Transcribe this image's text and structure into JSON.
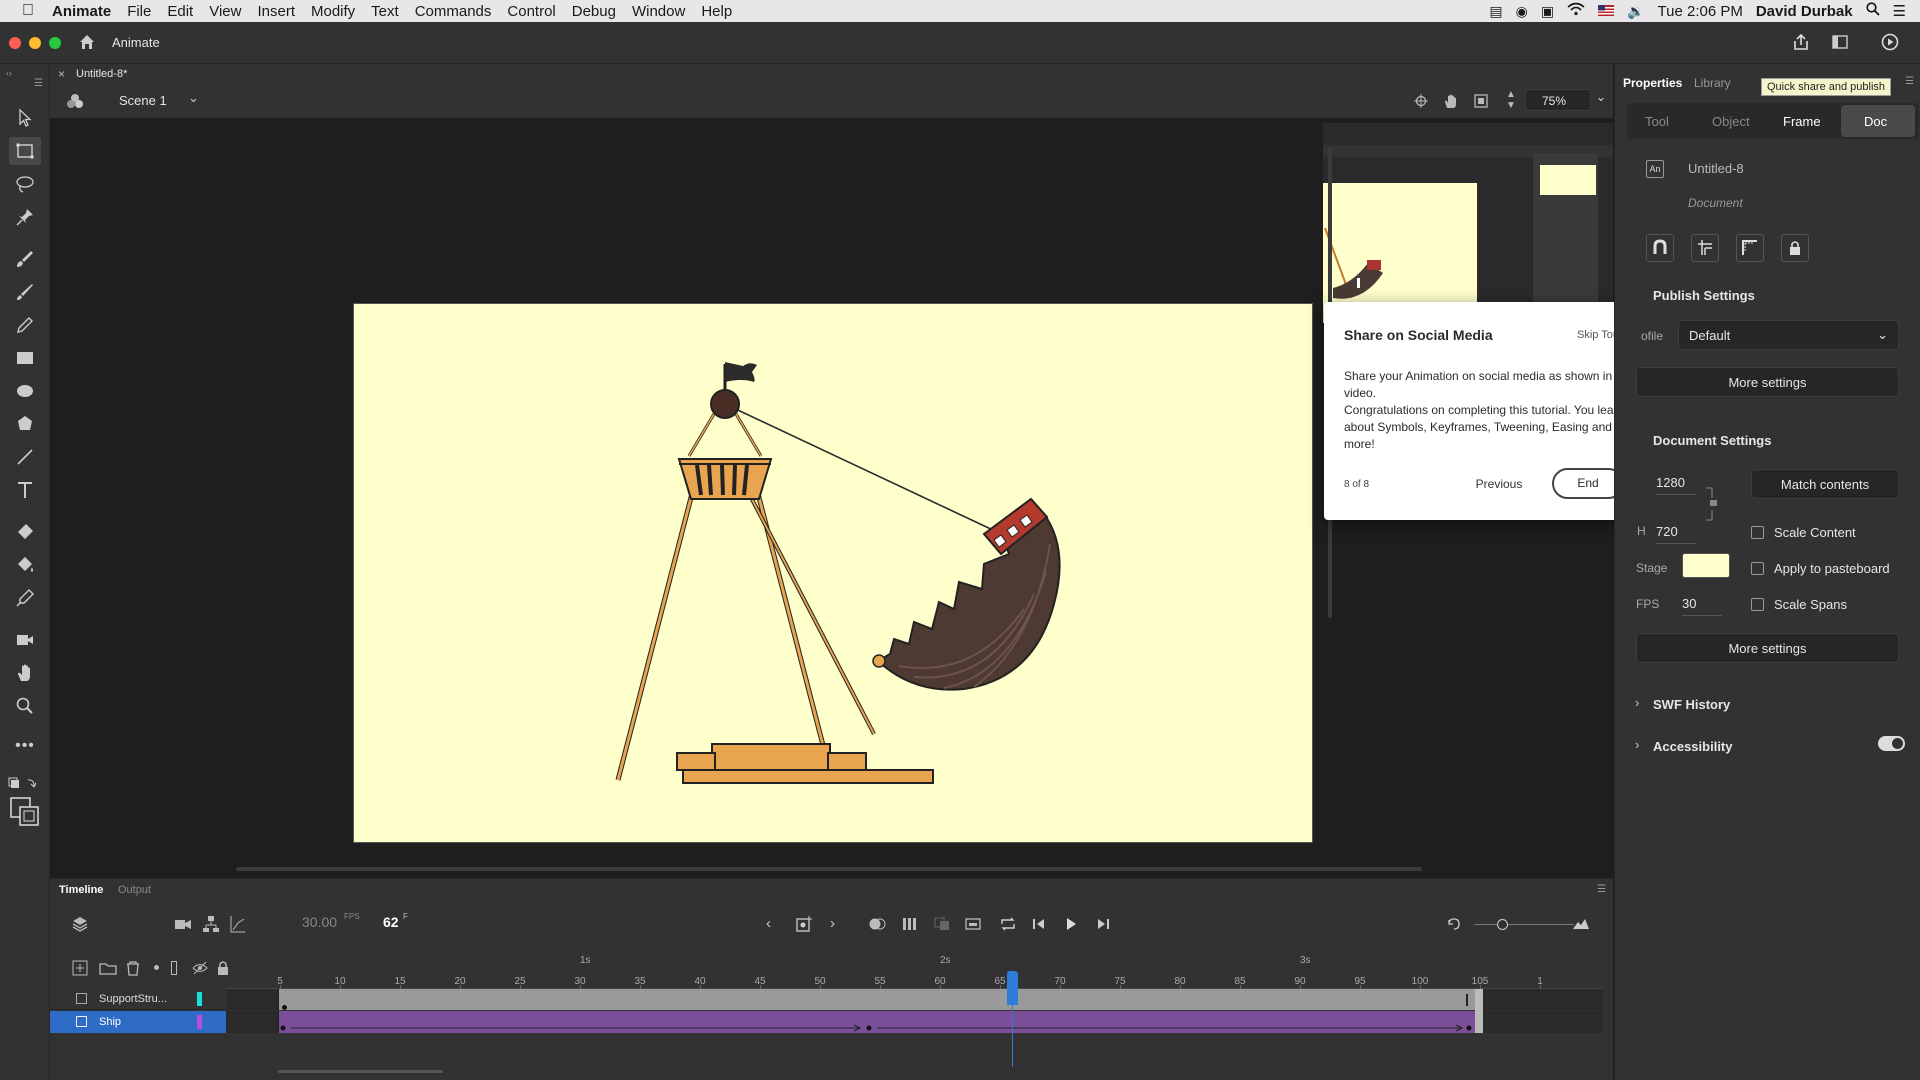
{
  "menubar": {
    "app_name": "Animate",
    "items": [
      "File",
      "Edit",
      "View",
      "Insert",
      "Modify",
      "Text",
      "Commands",
      "Control",
      "Debug",
      "Window",
      "Help"
    ],
    "clock": "Tue 2:06 PM",
    "user": "David Durbak"
  },
  "appbar": {
    "title": "Animate"
  },
  "document": {
    "tab_label": "Untitled-8*"
  },
  "scene": {
    "name": "Scene 1",
    "zoom": "75%"
  },
  "popup": {
    "title": "Share on Social Media",
    "skip": "Skip Tour",
    "body": "Share your Animation on social media as shown in the video.\nCongratulations on completing this tutorial. You learnt about Symbols, Keyframes, Tweening, Easing and more!",
    "step": "8 of 8",
    "prev": "Previous",
    "end": "End"
  },
  "tooltip": "Quick share and publish",
  "properties": {
    "panel_tabs": [
      "Properties",
      "Library"
    ],
    "subtabs": [
      "Tool",
      "Object",
      "Frame",
      "Doc"
    ],
    "doc_name": "Untitled-8",
    "doc_type": "Document",
    "publish_settings": "Publish Settings",
    "profile_label": "ofile",
    "profile_value": "Default",
    "more_settings": "More settings",
    "document_settings": "Document Settings",
    "width": "1280",
    "height_label": "H",
    "height": "720",
    "match_contents": "Match contents",
    "scale_content": "Scale Content",
    "apply_pasteboard": "Apply to pasteboard",
    "scale_spans": "Scale Spans",
    "stage_label": "Stage",
    "stage_color": "#ffffcc",
    "fps_label": "FPS",
    "fps": "30",
    "more_settings2": "More settings",
    "swf_history": "SWF History",
    "accessibility": "Accessibility"
  },
  "timeline": {
    "tabs": [
      "Timeline",
      "Output"
    ],
    "fps": "30.00",
    "fps_unit": "FPS",
    "frame": "62",
    "frame_unit": "F",
    "seconds": [
      "1s",
      "2s",
      "3s"
    ],
    "frame_numbers": [
      "5",
      "10",
      "15",
      "20",
      "25",
      "30",
      "35",
      "40",
      "45",
      "50",
      "55",
      "60",
      "65",
      "70",
      "75",
      "80",
      "85",
      "90",
      "95",
      "100",
      "105",
      "1"
    ],
    "layers": [
      {
        "name": "SupportStru...",
        "color": "#19e0e0"
      },
      {
        "name": "Ship",
        "color": "#b84ee0"
      }
    ],
    "playhead_frame": 62
  },
  "colors": {
    "accent": "#2e6bc7",
    "popup_bg": "#ffffff",
    "tween": "#7b4e99"
  }
}
